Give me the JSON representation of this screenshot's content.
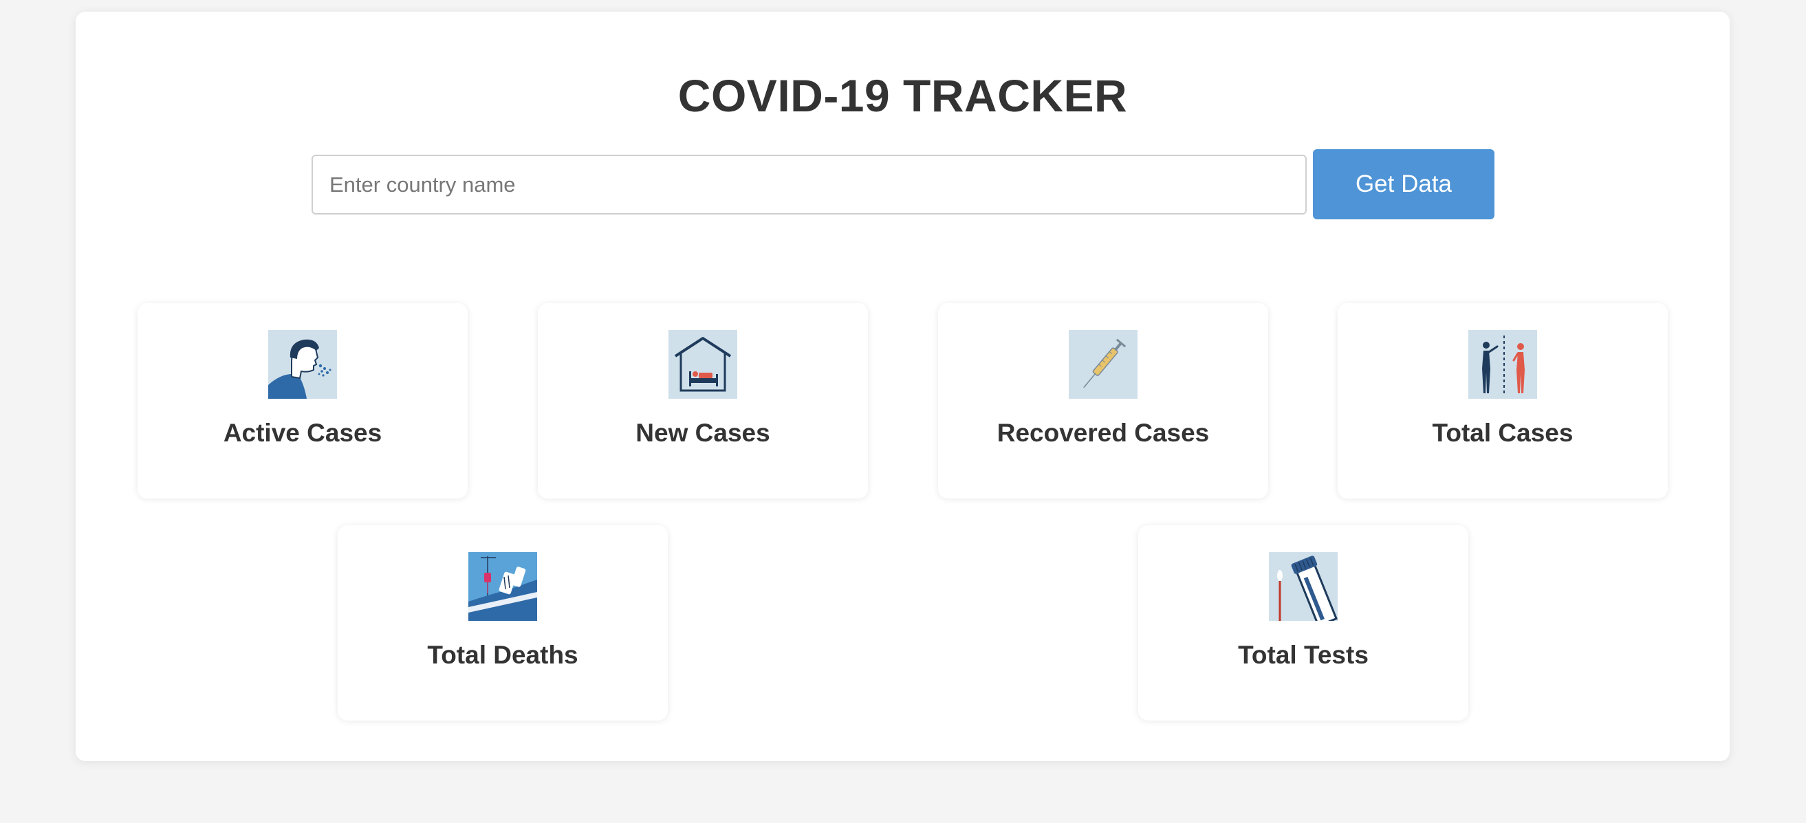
{
  "header": {
    "title": "COVID-19 TRACKER"
  },
  "search": {
    "placeholder": "Enter country name",
    "value": "",
    "button_label": "Get Data"
  },
  "cards": [
    {
      "label": "Active Cases",
      "icon": "coughing-person-icon"
    },
    {
      "label": "New Cases",
      "icon": "house-bed-icon"
    },
    {
      "label": "Recovered Cases",
      "icon": "syringe-icon"
    },
    {
      "label": "Total Cases",
      "icon": "distancing-people-icon"
    },
    {
      "label": "Total Deaths",
      "icon": "hospital-bed-icon"
    },
    {
      "label": "Total Tests",
      "icon": "test-tube-swab-icon"
    }
  ],
  "colors": {
    "accent": "#4e94d6",
    "text": "#333333",
    "background": "#f4f4f4",
    "icon_background": "#cfe0ea"
  }
}
